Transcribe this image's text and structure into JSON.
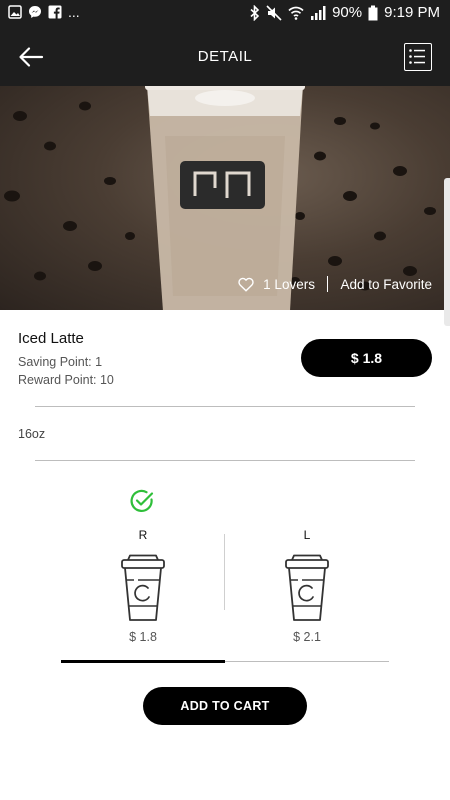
{
  "status_bar": {
    "battery": "90%",
    "time": "9:19 PM",
    "more": "...",
    "icons": [
      "gallery-icon",
      "messenger-icon",
      "facebook-icon",
      "bluetooth-icon",
      "mute-icon",
      "wifi-icon",
      "signal-icon",
      "battery-icon"
    ]
  },
  "app_bar": {
    "title": "DETAIL",
    "icons": [
      "back-arrow-icon",
      "list-menu-icon"
    ]
  },
  "hero": {
    "lovers": "1 Lovers",
    "add_favorite": "Add to Favorite",
    "icons": [
      "heart-icon"
    ]
  },
  "product": {
    "name": "Iced Latte",
    "saving_point": "Saving Point: 1",
    "reward_point": "Reward Point: 10",
    "price": "$ 1.8",
    "spec": "16oz"
  },
  "sizes": [
    {
      "label": "R",
      "price": "$ 1.8",
      "selected": true
    },
    {
      "label": "L",
      "price": "$ 2.1",
      "selected": false
    }
  ],
  "actions": {
    "add_to_cart": "ADD TO CART"
  },
  "colors": {
    "app_bar_bg": "#1e1e1e",
    "button_bg": "#000000",
    "check_green": "#2fbf3a"
  }
}
